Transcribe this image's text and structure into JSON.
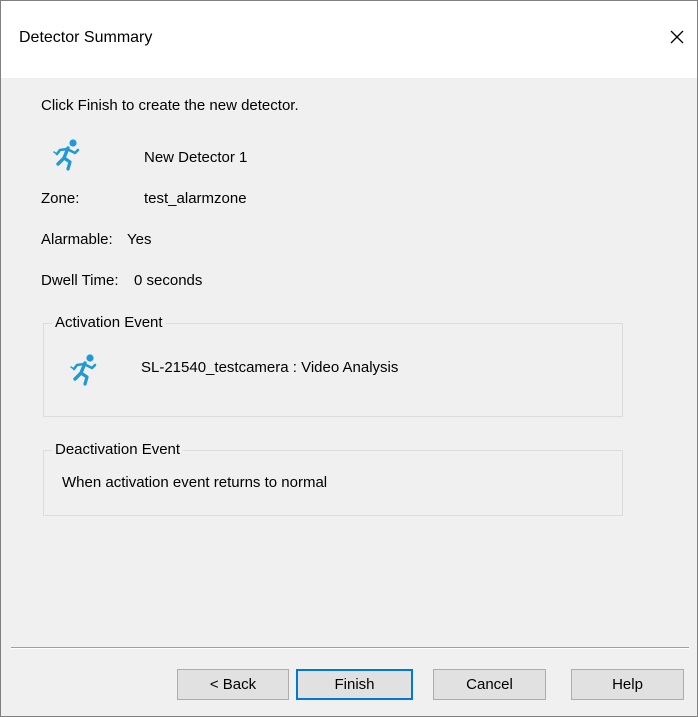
{
  "window": {
    "title": "Detector Summary",
    "close_glyph": "✕"
  },
  "summary": {
    "instruction": "Click Finish to create the new detector.",
    "detector_name": "New Detector 1",
    "zone_label": "Zone:",
    "zone_value": "test_alarmzone",
    "alarmable_label": "Alarmable:",
    "alarmable_value": "Yes",
    "dwell_label": "Dwell Time:",
    "dwell_value": "0 seconds"
  },
  "activation": {
    "title": "Activation Event",
    "event": "SL-21540_testcamera : Video Analysis"
  },
  "deactivation": {
    "title": "Deactivation Event",
    "text": "When activation event returns to normal"
  },
  "buttons": {
    "back": "< Back",
    "finish": "Finish",
    "cancel": "Cancel",
    "help": "Help"
  },
  "colors": {
    "icon_accent": "#1e9ad6",
    "default_button_border": "#0078d7",
    "dialog_background": "#f0f0f0"
  },
  "icons": {
    "detector": "running-person-icon",
    "close": "close-icon"
  }
}
